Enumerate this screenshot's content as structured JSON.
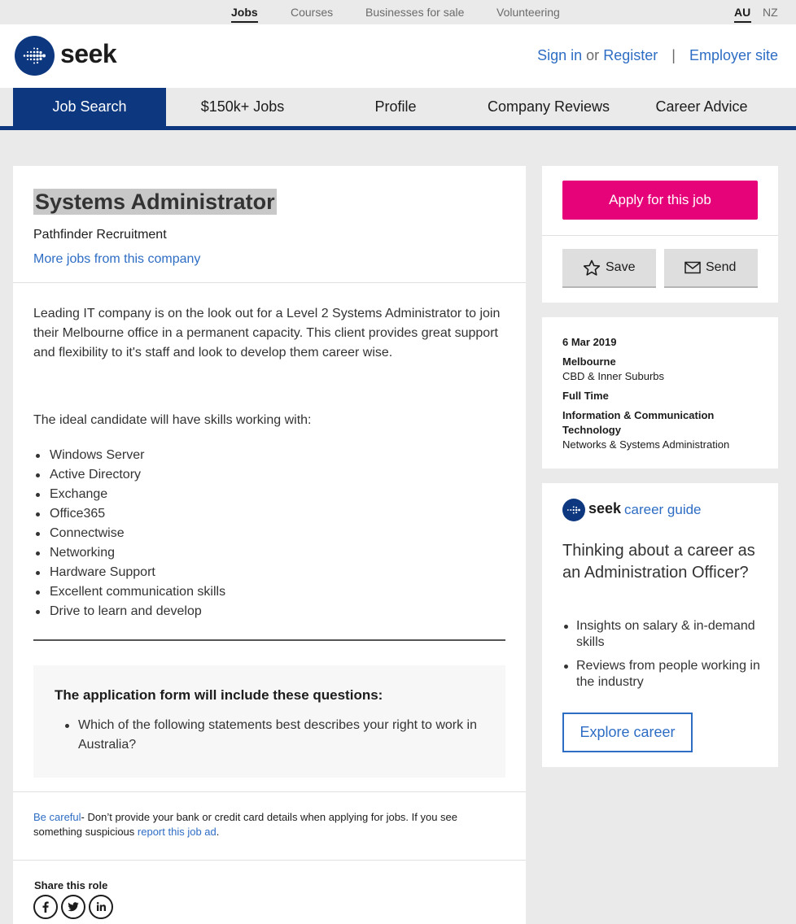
{
  "topbar": {
    "links": [
      "Jobs",
      "Courses",
      "Businesses for sale",
      "Volunteering"
    ],
    "regions": [
      "AU",
      "NZ"
    ]
  },
  "header": {
    "logo_text": "seek",
    "sign_in": "Sign in",
    "or": "or",
    "register": "Register",
    "sep": "|",
    "employer_site": "Employer site"
  },
  "nav": {
    "items": [
      "Job Search",
      "$150k+ Jobs",
      "Profile",
      "Company Reviews",
      "Career Advice"
    ]
  },
  "job": {
    "title": "Systems Administrator",
    "company": "Pathfinder Recruitment",
    "more_jobs": "More jobs from this company",
    "description": "Leading IT company is on the look out for a Level 2 Systems Administrator to join their Melbourne office in a permanent capacity. This client provides great support and flexibility to it's staff and look to develop them career wise.",
    "ideal": "The ideal candidate will have skills working with:",
    "skills": [
      "Windows Server",
      "Active Directory",
      "Exchange",
      "Office365",
      "Connectwise",
      "Networking",
      "Hardware Support",
      "Excellent communication skills",
      "Drive to learn and develop"
    ]
  },
  "questions": {
    "title": "The application form will include these questions:",
    "items": [
      "Which of the following statements best describes your right to work in Australia?"
    ]
  },
  "careful": {
    "link": "Be careful",
    "text": "- Don’t provide your bank or credit card details when applying for jobs. If you see something suspicious ",
    "report_link": "report this job ad",
    "end": "."
  },
  "share": {
    "title": "Share this role",
    "icons": [
      "facebook-icon",
      "twitter-icon",
      "linkedin-icon"
    ]
  },
  "actions": {
    "apply": "Apply for this job",
    "save": "Save",
    "send": "Send"
  },
  "details": {
    "date": "6 Mar 2019",
    "location": "Melbourne",
    "area": "CBD & Inner Suburbs",
    "work_type": "Full Time",
    "classification": "Information & Communication Technology",
    "sub_classification": "Networks & Systems Administration"
  },
  "career_guide": {
    "logo_seek": "seek",
    "logo_text": "career guide",
    "question": "Thinking about a career as an Administration Officer?",
    "points": [
      "Insights on salary & in-demand skills",
      "Reviews from people working in the industry"
    ],
    "button": "Explore career"
  },
  "colors": {
    "brand_navy": "#0d3880",
    "apply_pink": "#e60278",
    "link_blue": "#2e6dc4"
  }
}
